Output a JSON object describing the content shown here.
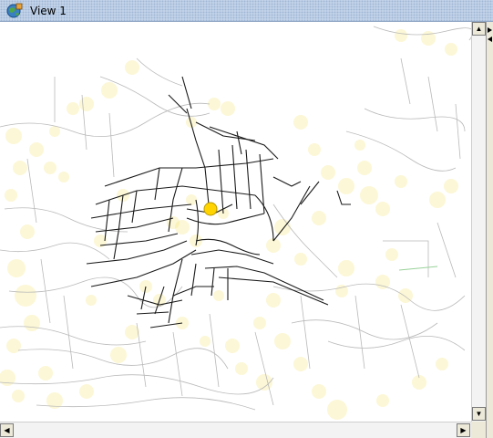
{
  "window": {
    "title": "View 1",
    "app_icon": "globe-icon"
  },
  "map": {
    "background_color": "#ffffff",
    "road_color": "#1a1a1a",
    "faint_road_color": "#b9b9b9",
    "heat_color": "#f6e26b",
    "marker_color": "#ffd400",
    "marker_stroke": "#b89a00"
  },
  "scrollbars": {
    "up_icon": "arrow-up-icon",
    "down_icon": "arrow-down-icon",
    "left_icon": "arrow-left-icon",
    "right_icon": "arrow-right-icon"
  }
}
